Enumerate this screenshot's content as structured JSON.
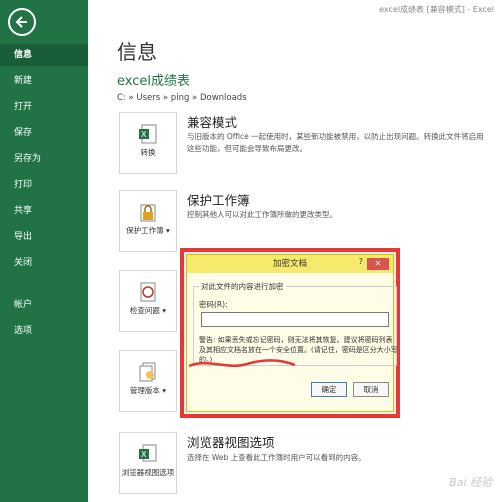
{
  "window": {
    "title": "excel成绩表 [兼容模式] - Excel"
  },
  "sidebar": {
    "items": [
      "信息",
      "新建",
      "打开",
      "保存",
      "另存为",
      "打印",
      "共享",
      "导出",
      "关闭",
      "帐户",
      "选项"
    ]
  },
  "main": {
    "title": "信息",
    "file_name": "excel成绩表",
    "path": "C: » Users » ping » Downloads",
    "compat": {
      "tile_label": "转换",
      "title": "兼容模式",
      "desc": "与旧版本的 Office 一起使用时，某些新功能被禁用，以防止出现问题。转换此文件将启用这些功能，但可能会导致布局更改。"
    },
    "protect": {
      "tile_label": "保护工作簿",
      "title": "保护工作簿",
      "desc": "控制其他人可以对此工作簿所做的更改类型。"
    },
    "inspect": {
      "tile_label": "检查问题"
    },
    "versions": {
      "tile_label": "管理版本"
    },
    "browser": {
      "tile_label": "浏览器视图选项",
      "title": "浏览器视图选项",
      "desc": "选择在 Web 上查看此工作簿时用户可以看到的内容。"
    }
  },
  "dialog": {
    "title": "加密文档",
    "help": "?",
    "close": "✕",
    "group_label": "对此文件的内容进行加密",
    "pw_label": "密码(R):",
    "pw_value": "",
    "warning": "警告: 如果丢失或忘记密码，则无法将其恢复。建议将密码列表及其相应文档名放在一个安全位置。(请记住，密码是区分大小写的。)",
    "ok": "确定",
    "cancel": "取消"
  },
  "watermark": "Bai 经验"
}
